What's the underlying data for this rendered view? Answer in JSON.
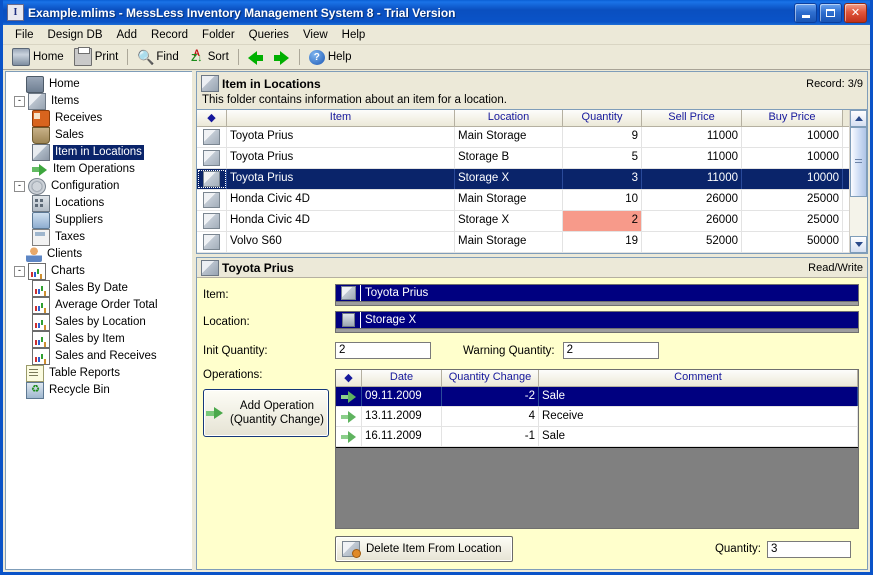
{
  "window": {
    "title": "Example.mlims - MessLess Inventory Management System 8 - Trial Version",
    "app_icon": "I",
    "minimize_label": "Minimize",
    "maximize_label": "Maximize",
    "close_label": "Close"
  },
  "menubar": {
    "items": [
      {
        "label": "File"
      },
      {
        "label": "Design DB"
      },
      {
        "label": "Add"
      },
      {
        "label": "Record"
      },
      {
        "label": "Folder"
      },
      {
        "label": "Queries"
      },
      {
        "label": "View"
      },
      {
        "label": "Help"
      }
    ]
  },
  "toolbar": {
    "items": [
      {
        "label": "Home",
        "icon": "home-icon"
      },
      {
        "label": "Print",
        "icon": "printer-icon"
      },
      {
        "label": "Find",
        "icon": "magnifier-icon"
      },
      {
        "label": "Sort",
        "icon": "sort-az-icon"
      },
      {
        "label": "Help",
        "icon": "help-circle-icon"
      }
    ],
    "nav_back": "back-arrow-icon",
    "nav_forward": "forward-arrow-icon"
  },
  "sidebar": {
    "items": [
      {
        "label": "Home",
        "level": 0,
        "icon": "home-icon",
        "expander": "",
        "selected": false
      },
      {
        "label": "Items",
        "level": 0,
        "icon": "box-icon",
        "expander": "-",
        "selected": false
      },
      {
        "label": "Receives",
        "level": 1,
        "icon": "truck-icon",
        "expander": "",
        "selected": false
      },
      {
        "label": "Sales",
        "level": 1,
        "icon": "cart-icon",
        "expander": "",
        "selected": false
      },
      {
        "label": "Item in Locations",
        "level": 1,
        "icon": "item-location-icon",
        "expander": "",
        "selected": true
      },
      {
        "label": "Item Operations",
        "level": 1,
        "icon": "green-arrow-icon",
        "expander": "",
        "selected": false
      },
      {
        "label": "Configuration",
        "level": 0,
        "icon": "gear-icon",
        "expander": "-",
        "selected": false
      },
      {
        "label": "Locations",
        "level": 1,
        "icon": "building-icon",
        "expander": "",
        "selected": false
      },
      {
        "label": "Suppliers",
        "level": 1,
        "icon": "supplier-icon",
        "expander": "",
        "selected": false
      },
      {
        "label": "Taxes",
        "level": 1,
        "icon": "tax-icon",
        "expander": "",
        "selected": false
      },
      {
        "label": "Clients",
        "level": 0,
        "icon": "client-icon",
        "expander": "",
        "selected": false
      },
      {
        "label": "Charts",
        "level": 0,
        "icon": "chart-icon",
        "expander": "-",
        "selected": false
      },
      {
        "label": "Sales By Date",
        "level": 1,
        "icon": "chart-icon",
        "expander": "",
        "selected": false
      },
      {
        "label": "Average Order Total",
        "level": 1,
        "icon": "chart-icon",
        "expander": "",
        "selected": false
      },
      {
        "label": "Sales by Location",
        "level": 1,
        "icon": "chart-icon",
        "expander": "",
        "selected": false
      },
      {
        "label": "Sales by Item",
        "level": 1,
        "icon": "chart-icon",
        "expander": "",
        "selected": false
      },
      {
        "label": "Sales and Receives",
        "level": 1,
        "icon": "chart-icon",
        "expander": "",
        "selected": false
      },
      {
        "label": "Table Reports",
        "level": 0,
        "icon": "report-icon",
        "expander": "",
        "selected": false
      },
      {
        "label": "Recycle Bin",
        "level": 0,
        "icon": "recycle-icon",
        "expander": "",
        "selected": false
      }
    ]
  },
  "folder": {
    "title": "Item in Locations",
    "record": "Record: 3/9",
    "description": "This folder contains information about an item for a location.",
    "icon": "item-location-icon"
  },
  "grid": {
    "columns": [
      "",
      "Item",
      "Location",
      "Quantity",
      "Sell Price",
      "Buy Price"
    ],
    "rows": [
      {
        "item": "Toyota Prius",
        "location": "Main Storage",
        "quantity": "9",
        "sell": "11000",
        "buy": "10000",
        "selected": false,
        "warn": false
      },
      {
        "item": "Toyota Prius",
        "location": "Storage B",
        "quantity": "5",
        "sell": "11000",
        "buy": "10000",
        "selected": false,
        "warn": false
      },
      {
        "item": "Toyota Prius",
        "location": "Storage X",
        "quantity": "3",
        "sell": "11000",
        "buy": "10000",
        "selected": true,
        "warn": false
      },
      {
        "item": "Honda Civic 4D",
        "location": "Main Storage",
        "quantity": "10",
        "sell": "26000",
        "buy": "25000",
        "selected": false,
        "warn": false
      },
      {
        "item": "Honda Civic 4D",
        "location": "Storage X",
        "quantity": "2",
        "sell": "26000",
        "buy": "25000",
        "selected": false,
        "warn": true
      },
      {
        "item": "Volvo S60",
        "location": "Main Storage",
        "quantity": "19",
        "sell": "52000",
        "buy": "50000",
        "selected": false,
        "warn": false
      }
    ]
  },
  "detail": {
    "title": "Toyota Prius",
    "access": "Read/Write",
    "icon": "item-location-icon",
    "item_label": "Item:",
    "item_value": "Toyota Prius",
    "location_label": "Location:",
    "location_value": "Storage X",
    "init_quantity_label": "Init Quantity:",
    "init_quantity_value": "2",
    "warning_quantity_label": "Warning Quantity:",
    "warning_quantity_value": "2",
    "operations_label": "Operations:",
    "add_operation_line1": "Add Operation",
    "add_operation_line2": "(Quantity Change)",
    "delete_button": "Delete Item From Location",
    "quantity_label": "Quantity:",
    "quantity_value": "3"
  },
  "operations": {
    "columns": [
      "",
      "Date",
      "Quantity Change",
      "Comment"
    ],
    "rows": [
      {
        "date": "09.11.2009",
        "change": "-2",
        "comment": "Sale",
        "selected": true
      },
      {
        "date": "13.11.2009",
        "change": "4",
        "comment": "Receive",
        "selected": false
      },
      {
        "date": "16.11.2009",
        "change": "-1",
        "comment": "Sale",
        "selected": false
      }
    ]
  },
  "colors": {
    "titlebar": "#0a53c8",
    "selection": "#0a246a",
    "form_background": "#ffffcc",
    "warning_cell": "#f79a8a",
    "header_text": "#16189c",
    "chrome": "#ece9d8"
  }
}
